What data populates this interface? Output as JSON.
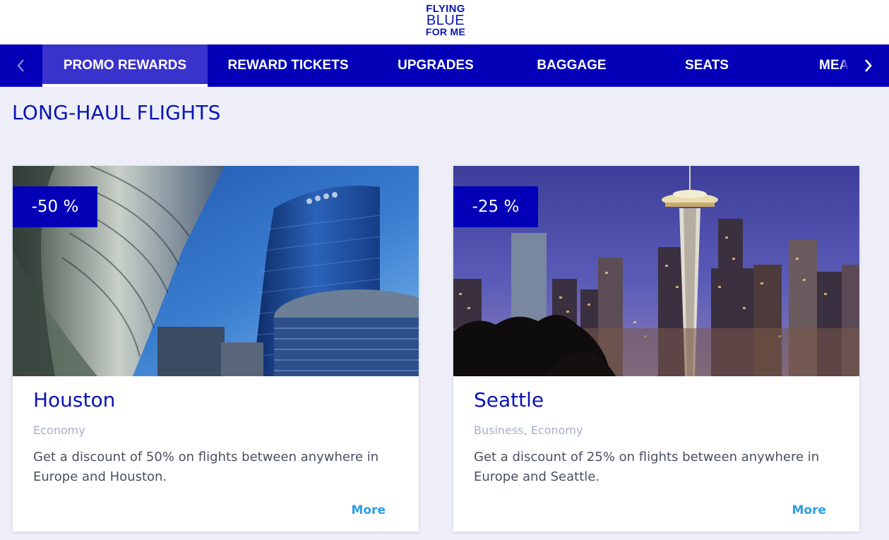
{
  "header": {
    "logo": {
      "line1": "FLYING",
      "line2": "BLUE",
      "line3": "FOR ME"
    }
  },
  "nav": {
    "prev_icon": "chevron-left-icon",
    "next_icon": "chevron-right-icon",
    "tabs": [
      {
        "label": "PROMO REWARDS",
        "active": true
      },
      {
        "label": "REWARD TICKETS",
        "active": false
      },
      {
        "label": "UPGRADES",
        "active": false
      },
      {
        "label": "BAGGAGE",
        "active": false
      },
      {
        "label": "SEATS",
        "active": false
      },
      {
        "label": "MEA",
        "active": false
      }
    ]
  },
  "main": {
    "section_title": "LONG-HAUL FLIGHTS",
    "cards": [
      {
        "image": "houston-skyline-photo",
        "badge": "-50 %",
        "title": "Houston",
        "cabin": "Economy",
        "description": "Get a discount of 50% on flights between anywhere in Europe and Houston.",
        "more": "More"
      },
      {
        "image": "seattle-skyline-photo",
        "badge": "-25 %",
        "title": "Seattle",
        "cabin": "Business, Economy",
        "description": "Get a discount of 25% on flights between anywhere in Europe and Seattle.",
        "more": "More"
      }
    ]
  },
  "colors": {
    "brand_blue": "#0400b8",
    "active_tab": "#3a32cc",
    "page_background": "#eeeef8",
    "link": "#2c9de6",
    "muted_text": "#a6b0c8"
  }
}
